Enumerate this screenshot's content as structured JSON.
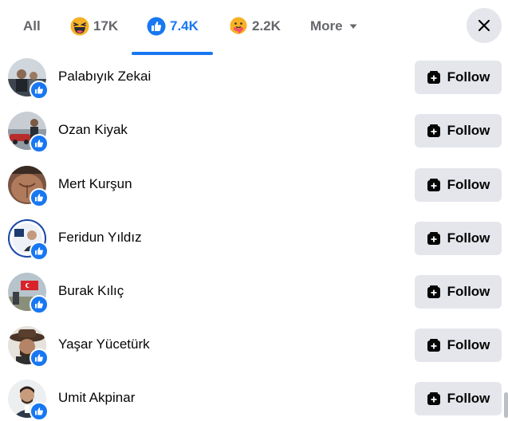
{
  "tabs": {
    "all_label": "All",
    "haha_count": "17K",
    "like_count": "7.4K",
    "care_count": "2.2K",
    "more_label": "More"
  },
  "colors": {
    "accent": "#1877f2",
    "button_bg": "#e4e6eb",
    "text_secondary": "#65676b"
  },
  "people": [
    {
      "name": "Palabıyık Zekai",
      "follow_label": "Follow"
    },
    {
      "name": "Ozan Kiyak",
      "follow_label": "Follow"
    },
    {
      "name": "Mert Kurşun",
      "follow_label": "Follow"
    },
    {
      "name": "Feridun Yıldız",
      "follow_label": "Follow"
    },
    {
      "name": "Burak Kılıç",
      "follow_label": "Follow"
    },
    {
      "name": "Yaşar Yücetürk",
      "follow_label": "Follow"
    },
    {
      "name": "Umit Akpinar",
      "follow_label": "Follow"
    }
  ]
}
